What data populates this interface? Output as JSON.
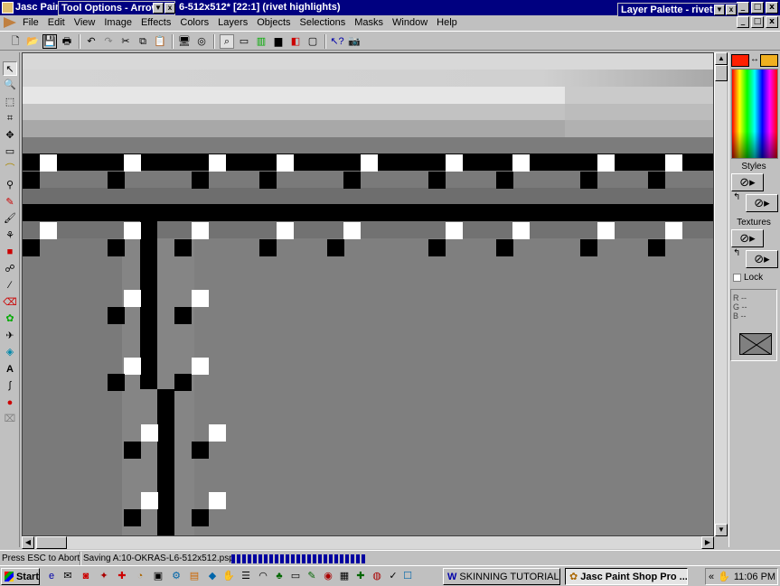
{
  "window": {
    "app_title": "Jasc Pain",
    "doc_title": "6-512x512* [22:1] (rivet highlights)"
  },
  "tool_options": {
    "title": "Tool Options - Arrow"
  },
  "layer_palette": {
    "title": "Layer Palette - rivet hi"
  },
  "menu": [
    "File",
    "Edit",
    "View",
    "Image",
    "Effects",
    "Colors",
    "Layers",
    "Objects",
    "Selections",
    "Masks",
    "Window",
    "Help"
  ],
  "palette": {
    "styles_label": "Styles",
    "textures_label": "Textures",
    "lock_label": "Lock",
    "rgb": [
      {
        "k": "R",
        "v": "--"
      },
      {
        "k": "G",
        "v": "--"
      },
      {
        "k": "B",
        "v": "--"
      }
    ],
    "fg_color": "#ff2000",
    "bg_color": "#f0b020"
  },
  "status": {
    "hint": "Press ESC to Abort",
    "saving": "Saving A:10-OKRAS-L6-512x512.psp",
    "progress": 1.0
  },
  "taskbar": {
    "start": "Start",
    "tasks": [
      {
        "label": "SKINNING TUTORIAL - ...",
        "active": false
      },
      {
        "label": "Jasc Paint Shop Pro ...",
        "active": true
      }
    ],
    "clock": "11:06 PM"
  },
  "colors": {
    "title_bar": "#000080",
    "canvas_grey": "#7b7b7b",
    "rivet_dark": "#000000",
    "rivet_highlight": "#ffffff"
  }
}
